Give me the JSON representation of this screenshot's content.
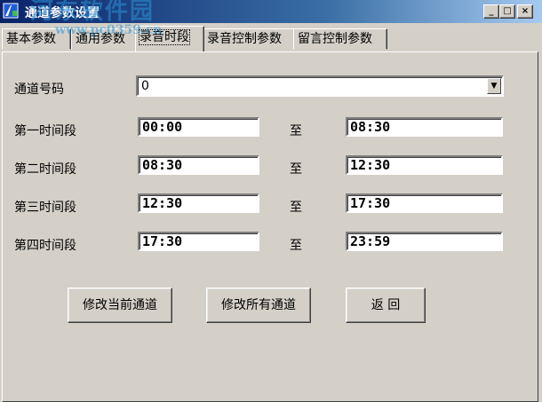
{
  "window": {
    "title": "通道参数设置",
    "watermark_text": "河东软件园",
    "watermark_url": "www.pc0359.cn",
    "controls": {
      "minimize": "_",
      "maximize": "□",
      "close": "×"
    }
  },
  "tabs": [
    {
      "label": "基本参数",
      "active": false
    },
    {
      "label": "通用参数",
      "active": false
    },
    {
      "label": "录音时段",
      "active": true
    },
    {
      "label": "录音控制参数",
      "active": false
    },
    {
      "label": "留言控制参数",
      "active": false
    }
  ],
  "form": {
    "channel_label": "通道号码",
    "channel_value": "0",
    "to_label": "至",
    "periods": [
      {
        "label": "第一时间段",
        "start": "00:00",
        "end": "08:30"
      },
      {
        "label": "第二时间段",
        "start": "08:30",
        "end": "12:30"
      },
      {
        "label": "第三时间段",
        "start": "12:30",
        "end": "17:30"
      },
      {
        "label": "第四时间段",
        "start": "17:30",
        "end": "23:59"
      }
    ]
  },
  "buttons": {
    "modify_current": "修改当前通道",
    "modify_all": "修改所有通道",
    "back": "返 回"
  },
  "colors": {
    "titlebar_start": "#0a246a",
    "titlebar_end": "#a6caf0",
    "face": "#d4d0c8"
  }
}
